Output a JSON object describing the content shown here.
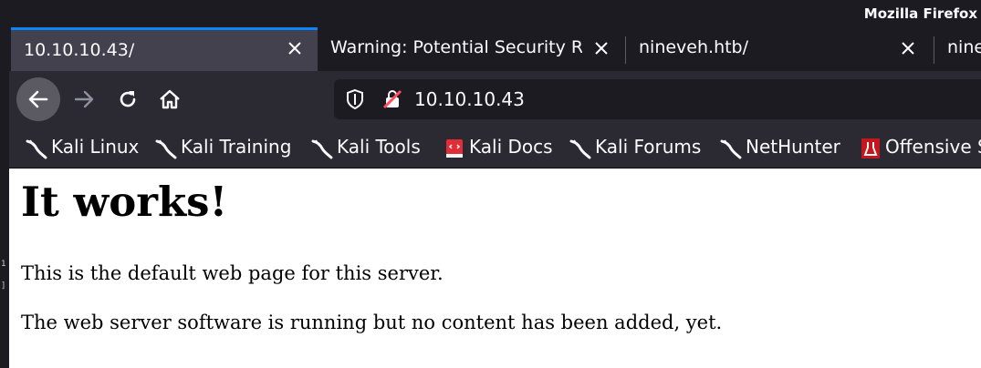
{
  "window": {
    "title": "Mozilla Firefox"
  },
  "tabs": [
    {
      "label": "10.10.10.43/",
      "active": true
    },
    {
      "label": "Warning: Potential Security R",
      "active": false
    },
    {
      "label": "nineveh.htb/",
      "active": false
    },
    {
      "label": "nine",
      "active": false
    }
  ],
  "navbar": {
    "url": "10.10.10.43"
  },
  "bookmarks": [
    {
      "label": "Kali Linux",
      "icon": "kali-dragon-icon"
    },
    {
      "label": "Kali Training",
      "icon": "kali-dragon-icon"
    },
    {
      "label": "Kali Tools",
      "icon": "kali-dragon-icon"
    },
    {
      "label": "Kali Docs",
      "icon": "kali-docs-icon"
    },
    {
      "label": "Kali Forums",
      "icon": "kali-dragon-icon"
    },
    {
      "label": "NetHunter",
      "icon": "kali-dragon-icon"
    },
    {
      "label": "Offensive S",
      "icon": "offsec-icon"
    }
  ],
  "page": {
    "heading": "It works!",
    "paragraph1": "This is the default web page for this server.",
    "paragraph2": "The web server software is running but no content has been added, yet."
  },
  "colors": {
    "accent": "#0a84ff",
    "chrome_dark": "#1c1b22",
    "toolbar": "#2b2a33",
    "active_tab": "#42414d"
  }
}
